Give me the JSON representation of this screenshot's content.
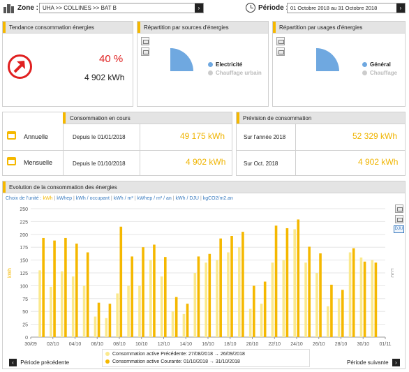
{
  "topbar": {
    "zone_label": "Zone :",
    "zone_value": "UHA >> COLLINES >> BAT B",
    "periode_label": "Période :",
    "periode_value": "01 Octobre 2018 au 31 Octobre 2018",
    "next_symbol": "›"
  },
  "tendance": {
    "title": "Tendance consommation énergies",
    "percent": "40 %",
    "value": "4 902 kWh"
  },
  "repartition_sources": {
    "title": "Répartition par sources d'énergies",
    "legend": [
      {
        "label": "Electricité",
        "color": "#6fa8e0",
        "active": true
      },
      {
        "label": "Chauffage urbain",
        "color": "#cccccc",
        "active": false
      }
    ]
  },
  "repartition_usages": {
    "title": "Répartition par usages d'énergies",
    "legend": [
      {
        "label": "Général",
        "color": "#6fa8e0",
        "active": true
      },
      {
        "label": "Chauffage",
        "color": "#cccccc",
        "active": false
      }
    ]
  },
  "conso_en_cours": {
    "title": "Consommation en cours",
    "rows": [
      {
        "label": "Annuelle",
        "since": "Depuis le 01/01/2018",
        "value": "49 175 kWh"
      },
      {
        "label": "Mensuelle",
        "since": "Depuis le 01/10/2018",
        "value": "4 902 kWh"
      }
    ]
  },
  "prevision": {
    "title": "Prévision de consommation",
    "rows": [
      {
        "label": "Sur l'année 2018",
        "value": "52 329 kWh"
      },
      {
        "label": "Sur Oct. 2018",
        "value": "4 902 kWh"
      }
    ]
  },
  "evolution": {
    "title": "Evolution de la consommation des énergies",
    "unit_label": "Choix de l'unité :",
    "units": [
      "kWh",
      "kWhep",
      "kWh / occupant",
      "kWh / m²",
      "kWhep / m² / an",
      "kWh / DJU",
      "kgCO2/m2.an"
    ],
    "active_unit": "kWh",
    "side_button": "DJU",
    "prev_label": "Période précédente",
    "next_label": "Période suivante",
    "legend": [
      {
        "label": "Consommation active Précédente: 27/08/2018 → 26/09/2018",
        "color": "#fbe98c"
      },
      {
        "label": "Consommation active Courante: 01/10/2018 → 31/10/2018",
        "color": "#f5b800"
      }
    ]
  },
  "chart_data": {
    "type": "bar",
    "ylabel": "kWh",
    "y2label": "DJU",
    "ylim": [
      0,
      250
    ],
    "yticks": [
      0,
      25,
      50,
      75,
      100,
      125,
      150,
      175,
      200,
      225,
      250
    ],
    "xtick_labels": [
      "30/09",
      "02/10",
      "04/10",
      "06/10",
      "08/10",
      "10/10",
      "12/10",
      "14/10",
      "16/10",
      "18/10",
      "20/10",
      "22/10",
      "24/10",
      "26/10",
      "28/10",
      "30/10",
      "01/11"
    ],
    "categories": [
      "01/10",
      "02/10",
      "03/10",
      "04/10",
      "05/10",
      "06/10",
      "07/10",
      "08/10",
      "09/10",
      "10/10",
      "11/10",
      "12/10",
      "13/10",
      "14/10",
      "15/10",
      "16/10",
      "17/10",
      "18/10",
      "19/10",
      "20/10",
      "21/10",
      "22/10",
      "23/10",
      "24/10",
      "25/10",
      "26/10",
      "27/10",
      "28/10",
      "29/10",
      "30/10",
      "31/10"
    ],
    "series": [
      {
        "name": "Consommation active Précédente",
        "color": "#fbe98c",
        "values": [
          130,
          98,
          128,
          118,
          100,
          40,
          37,
          85,
          100,
          100,
          150,
          118,
          50,
          45,
          125,
          145,
          150,
          165,
          175,
          55,
          65,
          145,
          150,
          210,
          145,
          125,
          60,
          75,
          165,
          155,
          150
        ]
      },
      {
        "name": "Consommation active Courante",
        "color": "#f5b800",
        "values": [
          193,
          188,
          193,
          182,
          165,
          67,
          65,
          215,
          157,
          175,
          180,
          156,
          78,
          65,
          157,
          162,
          192,
          197,
          205,
          100,
          108,
          217,
          212,
          229,
          176,
          163,
          102,
          92,
          173,
          147,
          145
        ]
      }
    ],
    "grid": true,
    "legend_position": "bottom-center"
  }
}
